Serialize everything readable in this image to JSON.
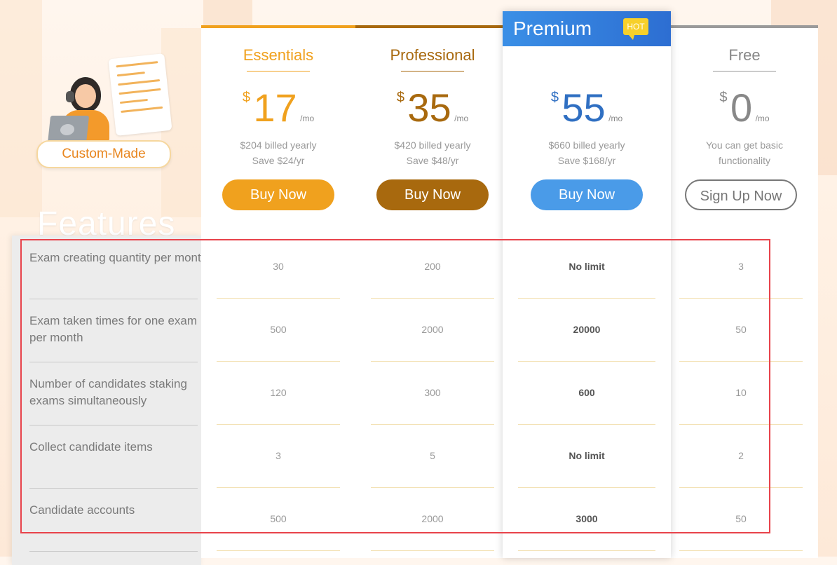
{
  "colors": {
    "essentials": "#f0a11e",
    "professional": "#a8690e",
    "premium": "#3a8fe6",
    "free_border": "#888888",
    "highlight_box": "#e8434b"
  },
  "brand": {
    "badge_label": "Custom-Made",
    "illustration": "support-agent-illustration"
  },
  "features_title": "Features",
  "features": [
    "Exam creating quantity per month",
    "Exam taken times for one exam per month",
    "Number of candidates staking exams simultaneously",
    "Collect candidate items",
    "Candidate accounts"
  ],
  "plans": {
    "essentials": {
      "name": "Essentials",
      "currency": "$",
      "amount": "17",
      "period": "/mo",
      "billed": "$204 billed yearly",
      "save": "Save $24/yr",
      "button": "Buy Now",
      "values": [
        "30",
        "500",
        "120",
        "3",
        "500"
      ]
    },
    "professional": {
      "name": "Professional",
      "currency": "$",
      "amount": "35",
      "period": "/mo",
      "billed": "$420 billed yearly",
      "save": "Save $48/yr",
      "button": "Buy Now",
      "values": [
        "200",
        "2000",
        "300",
        "5",
        "2000"
      ]
    },
    "premium": {
      "name": "Premium",
      "badge": "HOT",
      "currency": "$",
      "amount": "55",
      "period": "/mo",
      "billed": "$660 billed yearly",
      "save": "Save $168/yr",
      "button": "Buy Now",
      "values": [
        "No limit",
        "20000",
        "600",
        "No limit",
        "3000"
      ]
    },
    "free": {
      "name": "Free",
      "currency": "$",
      "amount": "0",
      "period": "/mo",
      "billed": "You can get basic",
      "save": "functionality",
      "button": "Sign Up Now",
      "values": [
        "3",
        "50",
        "10",
        "2",
        "50"
      ]
    }
  }
}
